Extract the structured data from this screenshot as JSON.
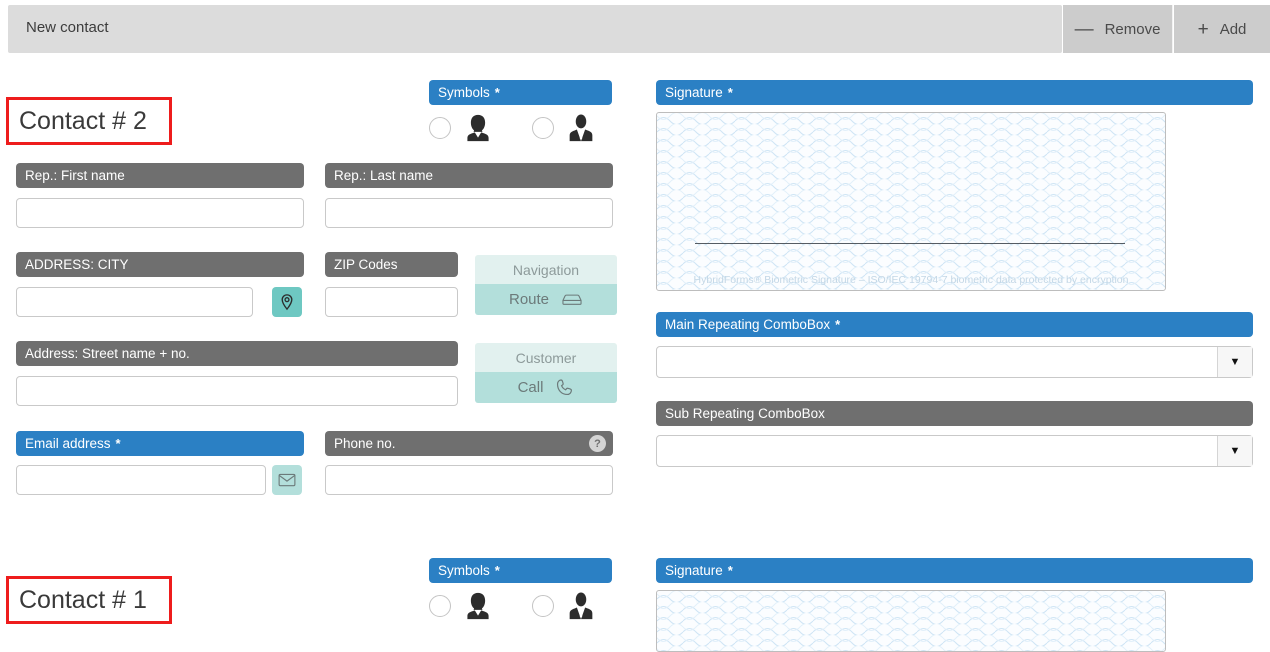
{
  "topbar": {
    "title": "New contact",
    "remove_label": "Remove",
    "remove_glyph": "—",
    "add_label": "Add",
    "add_glyph": "+"
  },
  "colors": {
    "header_blue": "#2b80c4",
    "header_gray": "#6f6f6f",
    "highlight_red": "#ee1c1c",
    "teal_dark": "#6ec8c2",
    "teal_light": "#b3dfdb",
    "teal_pale": "#e2f1ef",
    "toolbar_gray": "#dcdcdc",
    "button_gray": "#cccccc"
  },
  "contacts": [
    {
      "title": "Contact # 2",
      "symbols": {
        "label": "Symbols",
        "required": "*",
        "options": [
          {
            "icon": "female-person-icon",
            "selected": false
          },
          {
            "icon": "male-person-icon",
            "selected": false
          }
        ]
      },
      "signature": {
        "label": "Signature",
        "required": "*",
        "footer": "HybridForms® Biometric Signature  –  ISO/IEC 19794-7 biometric data protected by encryption",
        "value": ""
      },
      "fields": {
        "rep_first_name": {
          "label": "Rep.: First name",
          "required": "",
          "value": "",
          "style": "gray"
        },
        "rep_last_name": {
          "label": "Rep.: Last name",
          "required": "",
          "value": "",
          "style": "gray"
        },
        "address_city": {
          "label": "ADDRESS: CITY",
          "required": "",
          "value": "",
          "style": "gray"
        },
        "zip_codes": {
          "label": "ZIP Codes",
          "required": "",
          "value": "",
          "style": "gray"
        },
        "street": {
          "label": "Address: Street name + no.",
          "required": "",
          "value": "",
          "style": "gray"
        },
        "email": {
          "label": "Email address",
          "required": "*",
          "value": "",
          "style": "blue"
        },
        "phone": {
          "label": "Phone no.",
          "required": "",
          "value": "",
          "style": "gray",
          "help": "?"
        }
      },
      "actions": {
        "navigation": {
          "title": "Navigation",
          "button": "Route",
          "icon": "car-icon"
        },
        "customer": {
          "title": "Customer",
          "button": "Call",
          "icon": "phone-icon"
        }
      },
      "combos": {
        "main": {
          "label": "Main Repeating ComboBox",
          "required": "*",
          "value": "",
          "style": "blue",
          "arrow": "▼"
        },
        "sub": {
          "label": "Sub Repeating ComboBox",
          "required": "",
          "value": "",
          "style": "gray",
          "arrow": "▼"
        }
      }
    },
    {
      "title": "Contact # 1",
      "symbols": {
        "label": "Symbols",
        "required": "*",
        "options": [
          {
            "icon": "female-person-icon",
            "selected": false
          },
          {
            "icon": "male-person-icon",
            "selected": false
          }
        ]
      },
      "signature": {
        "label": "Signature",
        "required": "*",
        "footer": "",
        "value": ""
      }
    }
  ]
}
